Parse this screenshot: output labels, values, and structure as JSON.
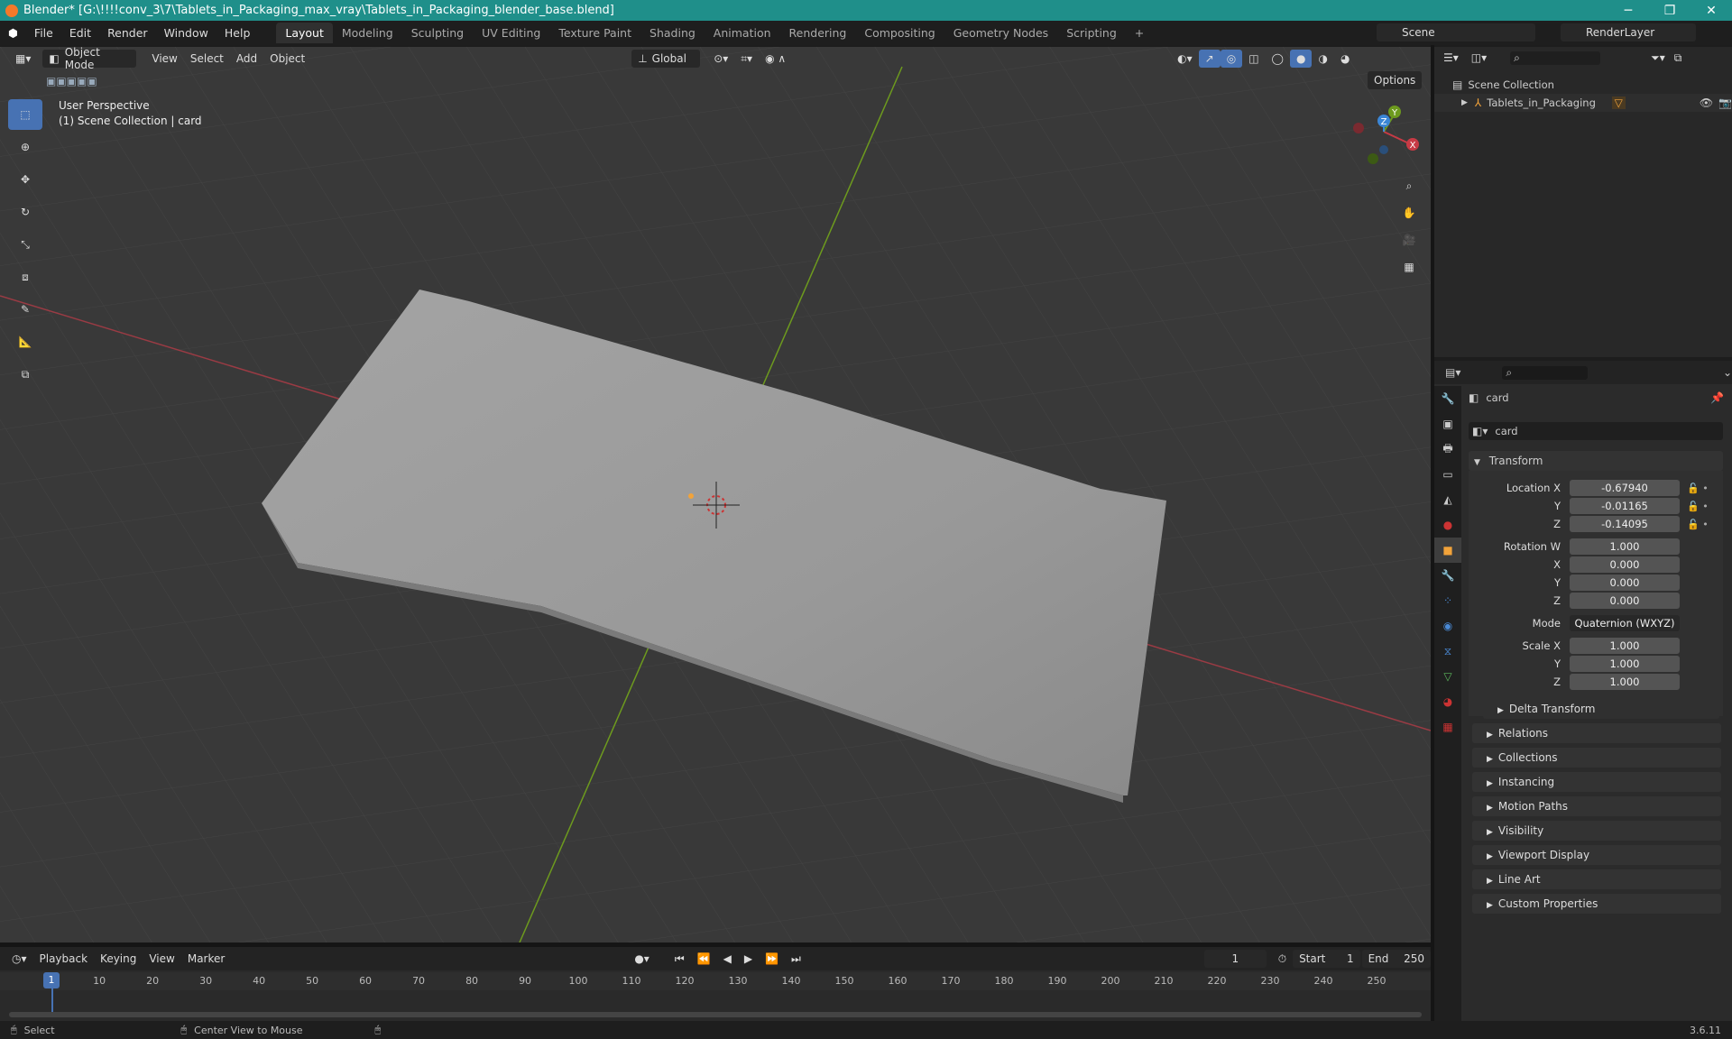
{
  "window": {
    "title": "Blender* [G:\\!!!!conv_3\\7\\Tablets_in_Packaging_max_vray\\Tablets_in_Packaging_blender_base.blend]"
  },
  "menu": [
    "File",
    "Edit",
    "Render",
    "Window",
    "Help"
  ],
  "workspaces": [
    "Layout",
    "Modeling",
    "Sculpting",
    "UV Editing",
    "Texture Paint",
    "Shading",
    "Animation",
    "Rendering",
    "Compositing",
    "Geometry Nodes",
    "Scripting"
  ],
  "active_workspace": "Layout",
  "scene": {
    "name": "Scene",
    "render_layer": "RenderLayer"
  },
  "viewport": {
    "mode": "Object Mode",
    "menus": [
      "View",
      "Select",
      "Add",
      "Object"
    ],
    "orientation": "Global",
    "options_label": "Options",
    "perspective": "User Perspective",
    "collection_info": "(1) Scene Collection | card",
    "gizmo_axes": {
      "x": "X",
      "y": "Y",
      "z": "Z"
    }
  },
  "outliner": {
    "root": "Scene Collection",
    "items": [
      {
        "label": "Tablets_in_Packaging"
      }
    ]
  },
  "properties": {
    "object_name": "card",
    "data_name": "card",
    "transform_title": "Transform",
    "location": {
      "label": "Location X",
      "x": "-0.67940",
      "y": "-0.01165",
      "z": "-0.14095"
    },
    "rotation": {
      "label": "Rotation W",
      "w": "1.000",
      "x": "0.000",
      "y": "0.000",
      "z": "0.000"
    },
    "mode": {
      "label": "Mode",
      "value": "Quaternion (WXYZ)"
    },
    "scale": {
      "label": "Scale X",
      "x": "1.000",
      "y": "1.000",
      "z": "1.000"
    },
    "axis_labels": {
      "y": "Y",
      "z": "Z",
      "x": "X"
    },
    "delta": "Delta Transform",
    "panels": [
      "Relations",
      "Collections",
      "Instancing",
      "Motion Paths",
      "Visibility",
      "Viewport Display",
      "Line Art",
      "Custom Properties"
    ]
  },
  "timeline": {
    "menus": [
      "Playback",
      "Keying",
      "View",
      "Marker"
    ],
    "current_frame": "1",
    "start_label": "Start",
    "start": "1",
    "end_label": "End",
    "end": "250",
    "ticks": [
      "1",
      "10",
      "20",
      "30",
      "40",
      "50",
      "60",
      "70",
      "80",
      "90",
      "100",
      "110",
      "120",
      "130",
      "140",
      "150",
      "160",
      "170",
      "180",
      "190",
      "200",
      "210",
      "220",
      "230",
      "240",
      "250"
    ]
  },
  "status": {
    "select": "Select",
    "center": "Center View to Mouse",
    "version": "3.6.11"
  },
  "colors": {
    "accent": "#4772b3",
    "title_bar": "#1f8f8a",
    "x_axis": "#c73a45",
    "y_axis": "#6d9a1e",
    "z_axis": "#3b86d6",
    "playhead": "#4772b3"
  }
}
